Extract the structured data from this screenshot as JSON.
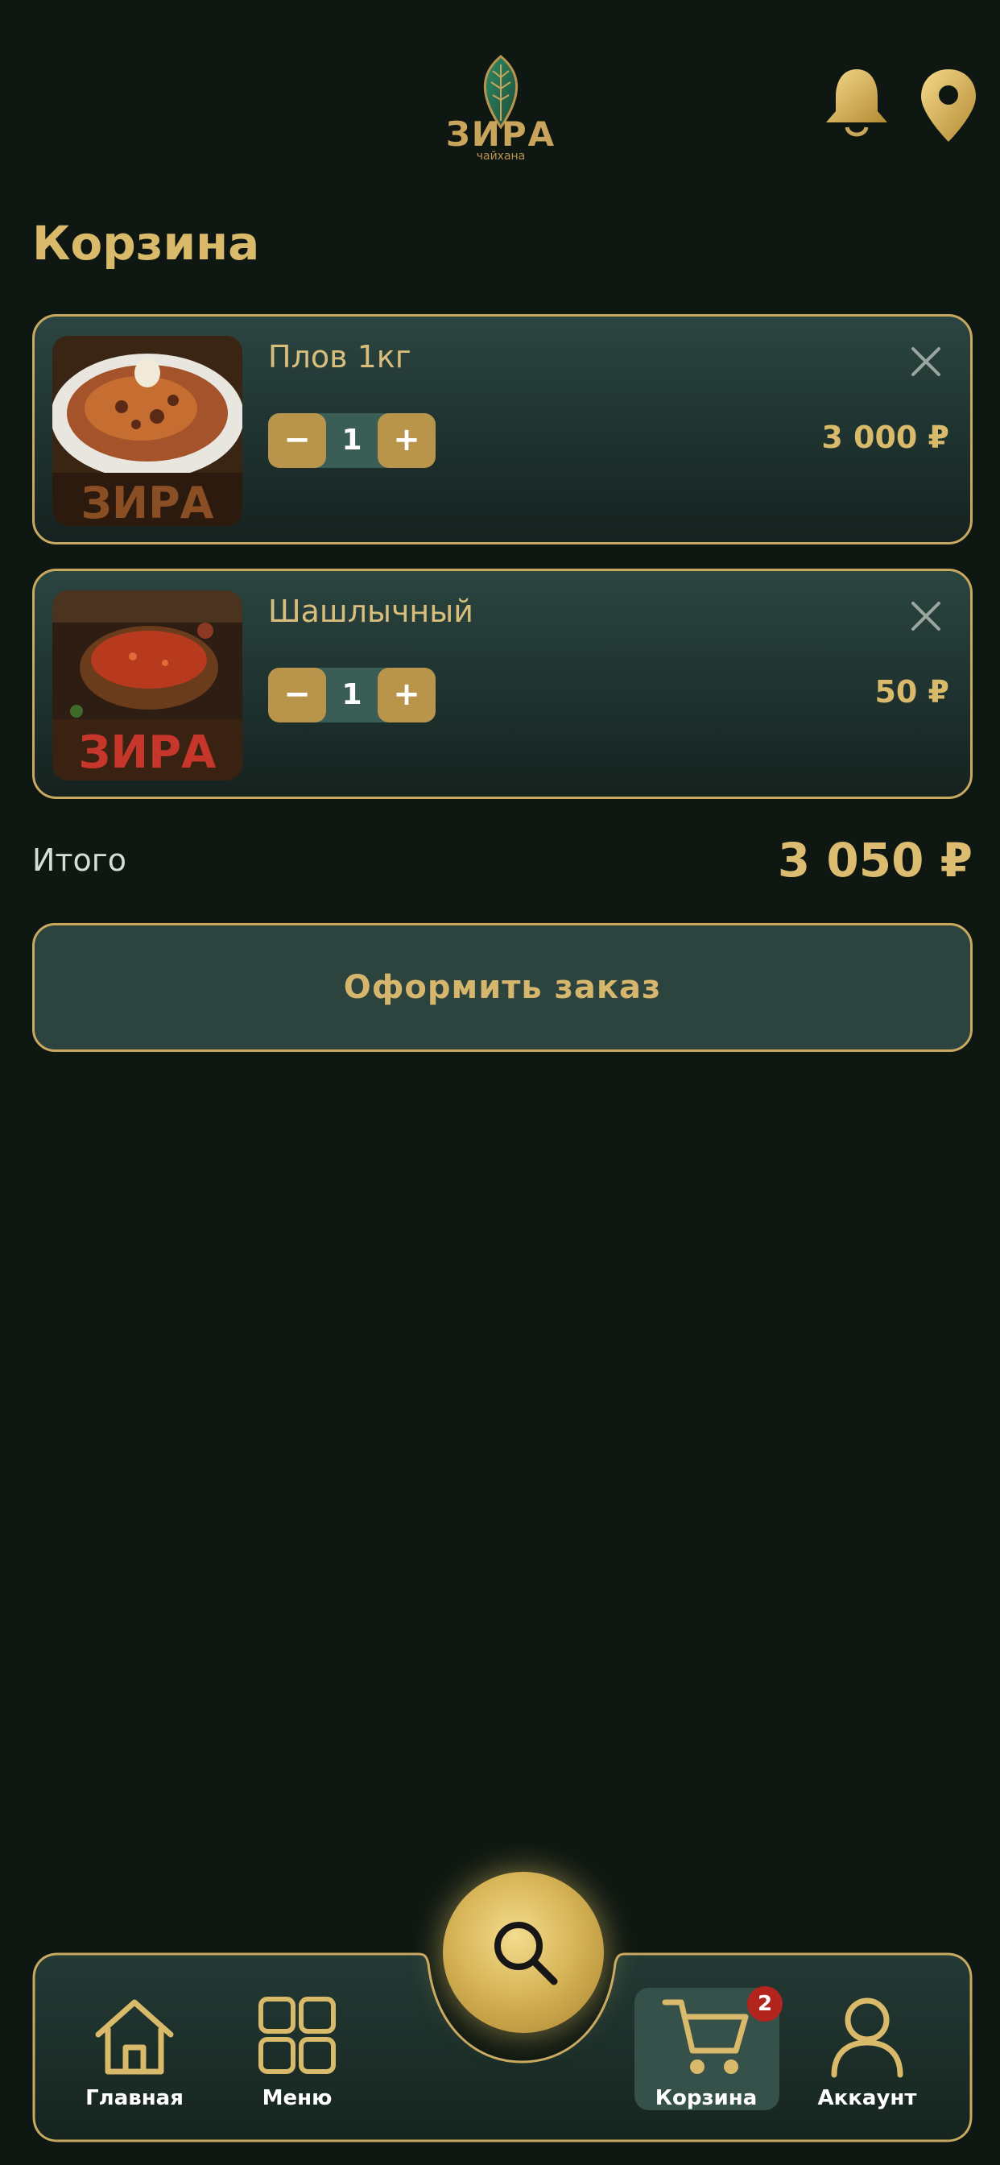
{
  "header": {
    "logo_word": "ЗИРА",
    "logo_sub": "чайхана",
    "icons": {
      "notifications": "bell-icon",
      "location": "map-pin-icon"
    }
  },
  "page": {
    "title": "Корзина"
  },
  "cart": {
    "items": [
      {
        "name": "Плов 1кг",
        "qty": "1",
        "price": "3 000 ₽",
        "minus": "−",
        "plus": "+",
        "image": "plov-photo"
      },
      {
        "name": "Шашлычный",
        "qty": "1",
        "price": "50 ₽",
        "minus": "−",
        "plus": "+",
        "image": "sauce-photo"
      }
    ],
    "total_label": "Итого",
    "total_value": "3 050 ₽",
    "checkout_label": "Оформить заказ"
  },
  "nav": {
    "items": [
      {
        "label": "Главная",
        "icon": "home-icon"
      },
      {
        "label": "Меню",
        "icon": "grid-icon"
      },
      {
        "label": "Корзина",
        "icon": "cart-icon",
        "active": true,
        "badge": "2"
      },
      {
        "label": "Аккаунт",
        "icon": "user-icon"
      }
    ],
    "search_icon": "search-icon"
  },
  "colors": {
    "background": "#0e1711",
    "gold": "#d9b96a",
    "card": "#233a36",
    "badge": "#b3241f"
  }
}
